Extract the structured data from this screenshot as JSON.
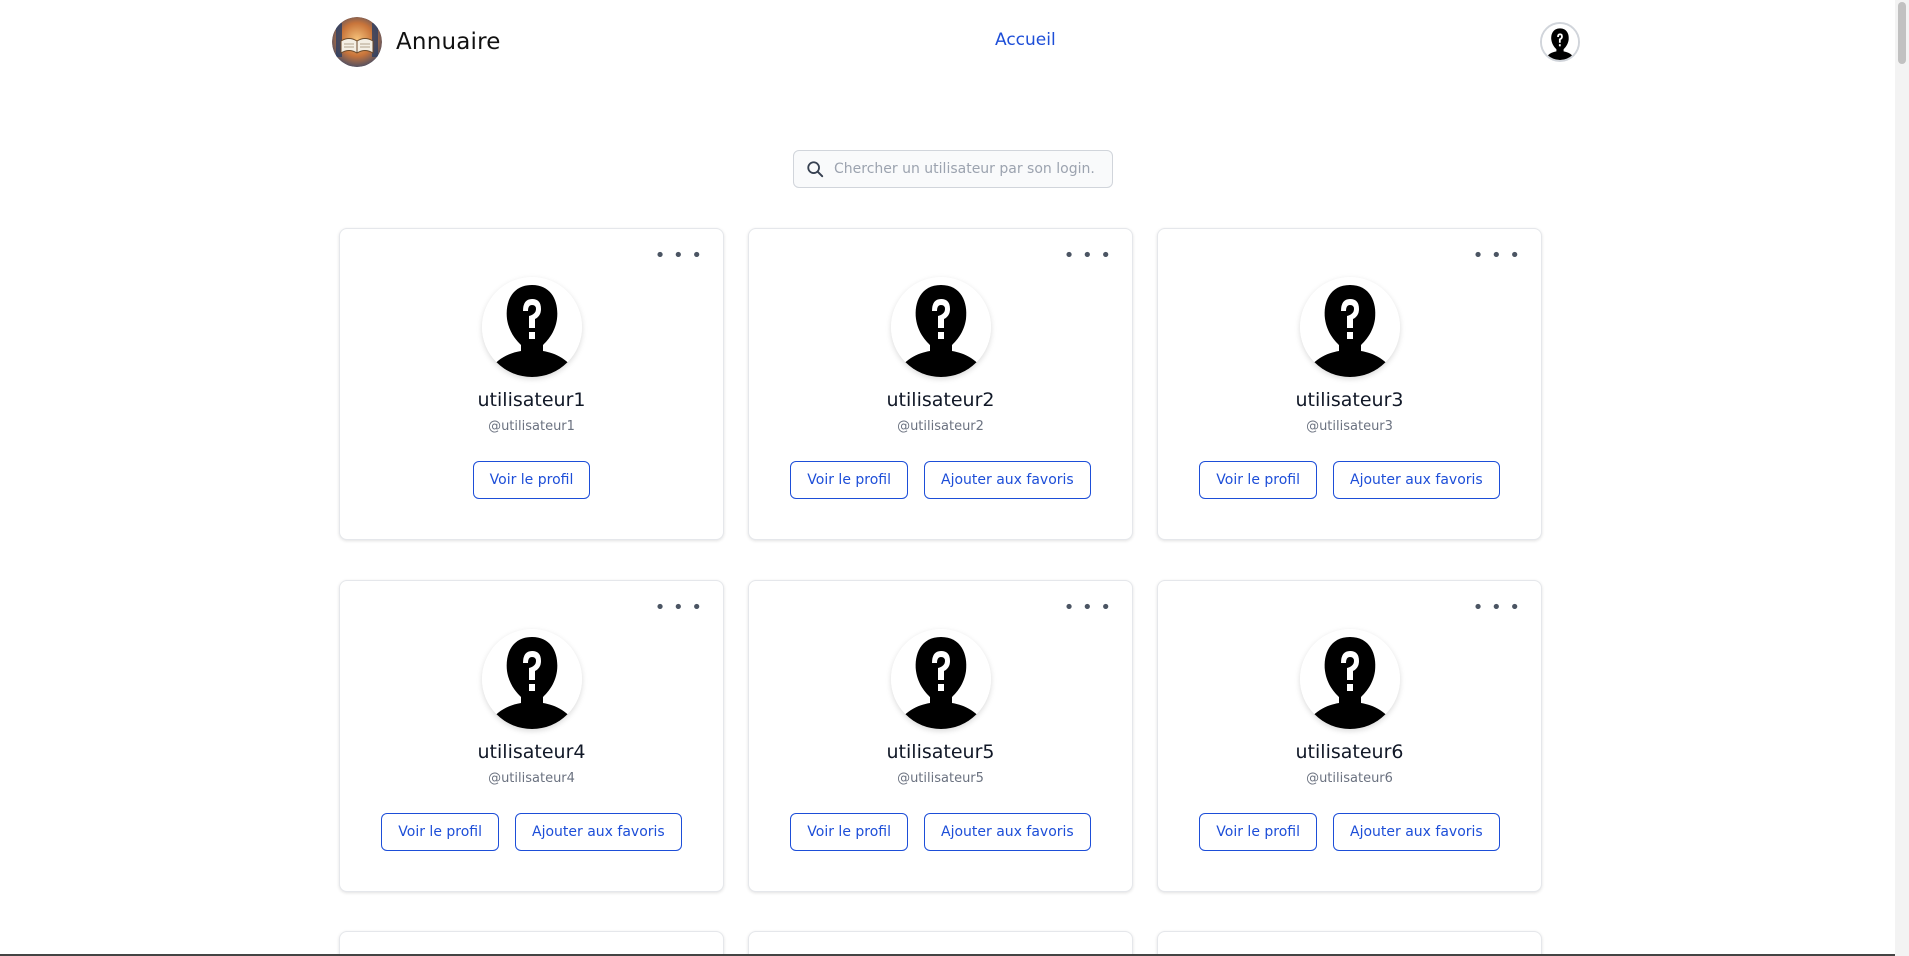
{
  "header": {
    "brand_title": "Annuaire",
    "nav_home": "Accueil"
  },
  "search": {
    "placeholder": "Chercher un utilisateur par son login..."
  },
  "cards": [
    {
      "name": "utilisateur1",
      "login": "@utilisateur1",
      "view_label": "Voir le profil",
      "fav_label": ""
    },
    {
      "name": "utilisateur2",
      "login": "@utilisateur2",
      "view_label": "Voir le profil",
      "fav_label": "Ajouter aux favoris"
    },
    {
      "name": "utilisateur3",
      "login": "@utilisateur3",
      "view_label": "Voir le profil",
      "fav_label": "Ajouter aux favoris"
    },
    {
      "name": "utilisateur4",
      "login": "@utilisateur4",
      "view_label": "Voir le profil",
      "fav_label": "Ajouter aux favoris"
    },
    {
      "name": "utilisateur5",
      "login": "@utilisateur5",
      "view_label": "Voir le profil",
      "fav_label": "Ajouter aux favoris"
    },
    {
      "name": "utilisateur6",
      "login": "@utilisateur6",
      "view_label": "Voir le profil",
      "fav_label": "Ajouter aux favoris"
    }
  ],
  "icons": {
    "search": "search-icon",
    "more": "more-options-icon",
    "avatar": "unknown-user-icon",
    "logo": "book-logo-icon"
  },
  "colors": {
    "accent": "#1d4ed8",
    "muted": "#6b7280",
    "border": "#e5e7eb"
  }
}
